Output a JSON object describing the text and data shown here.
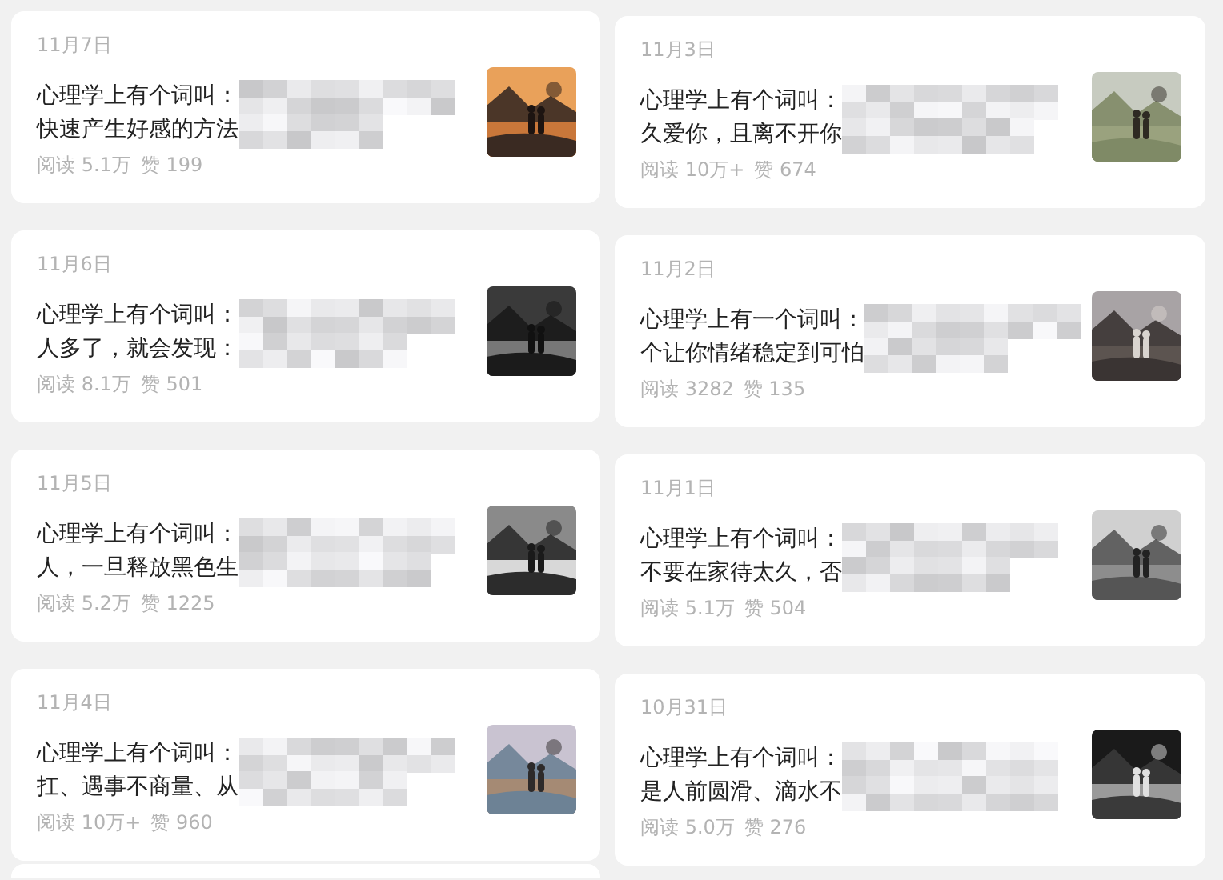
{
  "columns": [
    {
      "cards": [
        {
          "date": "11月7日",
          "title_lines": [
            "心理学上有个词叫：",
            "快速产生好感的方法"
          ],
          "reads": "阅读 5.1万",
          "likes": "赞 199"
        },
        {
          "date": "11月6日",
          "title_lines": [
            "心理学上有个词叫：",
            "人多了，就会发现："
          ],
          "reads": "阅读 8.1万",
          "likes": "赞 501"
        },
        {
          "date": "11月5日",
          "title_lines": [
            "心理学上有个词叫：",
            "人，一旦释放黑色生"
          ],
          "reads": "阅读 5.2万",
          "likes": "赞 1225"
        },
        {
          "date": "11月4日",
          "title_lines": [
            "心理学上有个词叫：",
            "扛、遇事不商量、从"
          ],
          "reads": "阅读 10万+",
          "likes": "赞 960"
        }
      ]
    },
    {
      "cards": [
        {
          "date": "11月3日",
          "title_lines": [
            "心理学上有个词叫：",
            "久爱你，且离不开你"
          ],
          "reads": "阅读 10万+",
          "likes": "赞 674"
        },
        {
          "date": "11月2日",
          "title_lines": [
            "心理学上有一个词叫：",
            "个让你情绪稳定到可怕"
          ],
          "reads": "阅读 3282",
          "likes": "赞 135"
        },
        {
          "date": "11月1日",
          "title_lines": [
            "心理学上有个词叫：",
            "不要在家待太久，否"
          ],
          "reads": "阅读 5.1万",
          "likes": "赞 504"
        },
        {
          "date": "10月31日",
          "title_lines": [
            "心理学上有个词叫：",
            "是人前圆滑、滴水不"
          ],
          "reads": "阅读 5.0万",
          "likes": "赞 276"
        }
      ]
    }
  ]
}
